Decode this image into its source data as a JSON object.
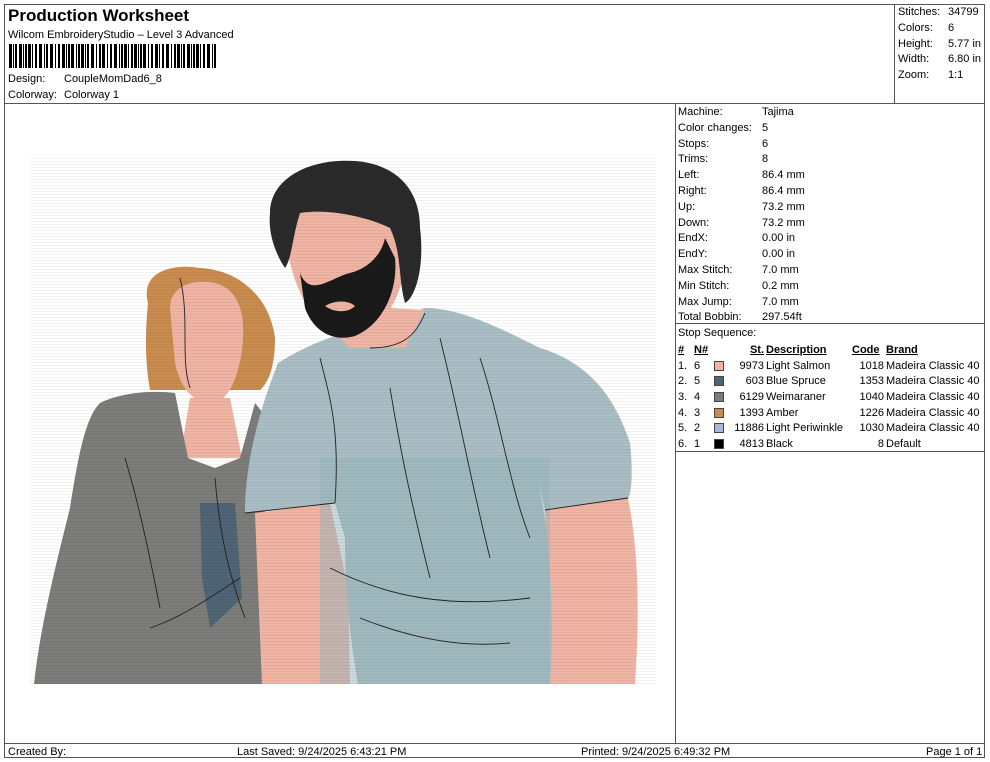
{
  "header": {
    "title": "Production Worksheet",
    "subtitle": "Wilcom EmbroideryStudio – Level 3 Advanced",
    "design_label": "Design:",
    "design_value": "CoupleMomDad6_8",
    "colorway_label": "Colorway:",
    "colorway_value": "Colorway 1"
  },
  "stats": [
    {
      "label": "Stitches:",
      "value": "34799"
    },
    {
      "label": "Colors:",
      "value": "6"
    },
    {
      "label": "Height:",
      "value": "5.77 in"
    },
    {
      "label": "Width:",
      "value": "6.80 in"
    },
    {
      "label": "Zoom:",
      "value": "1:1"
    }
  ],
  "info": [
    {
      "label": "Machine:",
      "value": "Tajima"
    },
    {
      "label": "Color changes:",
      "value": "5"
    },
    {
      "label": "Stops:",
      "value": "6"
    },
    {
      "label": "Trims:",
      "value": "8"
    },
    {
      "label": "Left:",
      "value": "86.4 mm"
    },
    {
      "label": "Right:",
      "value": "86.4 mm"
    },
    {
      "label": "Up:",
      "value": "73.2 mm"
    },
    {
      "label": "Down:",
      "value": "73.2 mm"
    },
    {
      "label": "EndX:",
      "value": "0.00 in"
    },
    {
      "label": "EndY:",
      "value": "0.00 in"
    },
    {
      "label": "Max Stitch:",
      "value": "7.0 mm"
    },
    {
      "label": "Min Stitch:",
      "value": "0.2 mm"
    },
    {
      "label": "Max Jump:",
      "value": "7.0 mm"
    },
    {
      "label": "Total Bobbin:",
      "value": "297.54ft"
    }
  ],
  "sequence": {
    "title": "Stop Sequence:",
    "headers": {
      "num": "#",
      "n": "N#",
      "st": "St.",
      "desc": "Description",
      "code": "Code",
      "brand": "Brand"
    },
    "rows": [
      {
        "num": "1.",
        "n": "6",
        "color": "#F0B4A4",
        "st": "9973",
        "desc": "Light Salmon",
        "code": "1018",
        "brand": "Madeira Classic 40"
      },
      {
        "num": "2.",
        "n": "5",
        "color": "#4F6474",
        "st": "603",
        "desc": "Blue Spruce",
        "code": "1353",
        "brand": "Madeira Classic 40"
      },
      {
        "num": "3.",
        "n": "4",
        "color": "#7C7D7A",
        "st": "6129",
        "desc": "Weimaraner",
        "code": "1040",
        "brand": "Madeira Classic 40"
      },
      {
        "num": "4.",
        "n": "3",
        "color": "#C98C4E",
        "st": "1393",
        "desc": "Amber",
        "code": "1226",
        "brand": "Madeira Classic 40"
      },
      {
        "num": "5.",
        "n": "2",
        "color": "#A7B8D6",
        "st": "11886",
        "desc": "Light Periwinkle",
        "code": "1030",
        "brand": "Madeira Classic 40"
      },
      {
        "num": "6.",
        "n": "1",
        "color": "#000000",
        "st": "4813",
        "desc": "Black",
        "code": "8",
        "brand": "Default"
      }
    ]
  },
  "footer": {
    "created": "Created By:",
    "last_saved": "Last Saved: 9/24/2025 6:43:21 PM",
    "printed": "Printed: 9/24/2025 6:49:32 PM",
    "page": "Page 1 of 1"
  }
}
